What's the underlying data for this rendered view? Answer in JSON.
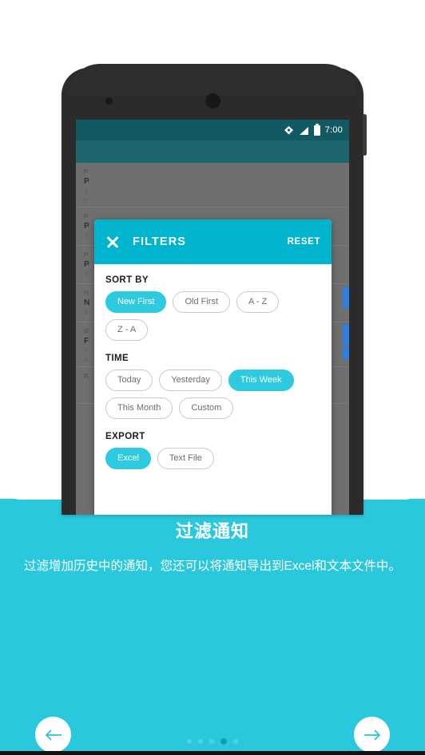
{
  "onboarding": {
    "title": "过滤通知",
    "description": "过滤增加历史中的通知，您还可以将通知导出到Excel和文本文件中。",
    "accent_color": "#29c8dc",
    "prev_icon": "arrow-left-icon",
    "next_icon": "arrow-right-icon",
    "dots": {
      "total": 5,
      "active_index": 3
    }
  },
  "phone": {
    "status_bar": {
      "time": "7:00",
      "icons": [
        "wifi-icon",
        "signal-icon",
        "battery-icon"
      ]
    }
  },
  "dialog": {
    "close_icon": "close-icon",
    "title": "FILTERS",
    "reset_label": "RESET",
    "header_color": "#00b4cd",
    "selected_chip_color": "#2ecbe0",
    "sections": [
      {
        "label": "SORT BY",
        "chips": [
          {
            "label": "New First",
            "selected": true
          },
          {
            "label": "Old First",
            "selected": false
          },
          {
            "label": "A - Z",
            "selected": false
          },
          {
            "label": "Z - A",
            "selected": false
          }
        ]
      },
      {
        "label": "TIME",
        "chips": [
          {
            "label": "Today",
            "selected": false
          },
          {
            "label": "Yesterday",
            "selected": false
          },
          {
            "label": "This Week",
            "selected": true
          },
          {
            "label": "This Month",
            "selected": false
          },
          {
            "label": "Custom",
            "selected": false
          }
        ]
      },
      {
        "label": "EXPORT",
        "chips": [
          {
            "label": "Excel",
            "selected": true
          },
          {
            "label": "Text File",
            "selected": false
          }
        ]
      }
    ]
  },
  "background_list": {
    "rows": [
      {
        "app": "P",
        "title": "P",
        "sub": "S",
        "sub2": "o"
      },
      {
        "app": "P",
        "title": "P",
        "sub": "S",
        "sub2": ""
      },
      {
        "app": "P",
        "title": "P",
        "sub": "S",
        "sub2": ""
      },
      {
        "app": "H",
        "title": "N",
        "sub": "a",
        "sub2": ""
      },
      {
        "app": "IF",
        "title": "F",
        "sub": "F",
        "sub2": "a"
      },
      {
        "app": "R",
        "title": "",
        "sub": "",
        "sub2": ""
      }
    ]
  }
}
